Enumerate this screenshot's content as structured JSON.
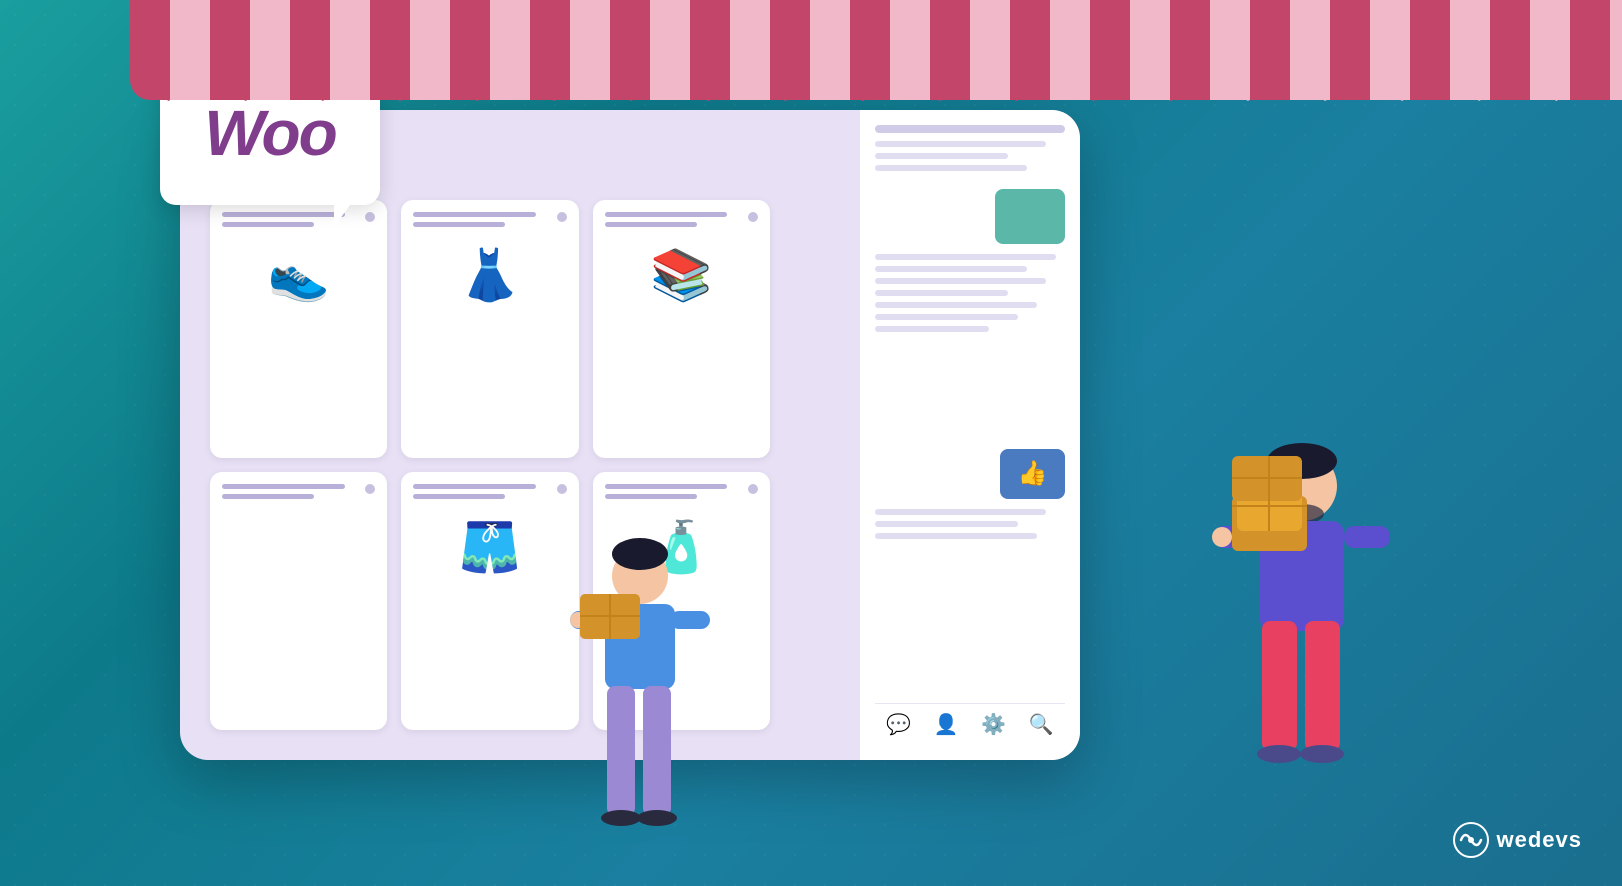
{
  "background": {
    "gradient_start": "#1a9e9e",
    "gradient_end": "#1a6e8e"
  },
  "woo_bubble": {
    "text": "Woo",
    "brand_color": "#7f3d8c"
  },
  "awning": {
    "color_dark": "#c4456a",
    "color_light": "#f0b8c8"
  },
  "product_cards": [
    {
      "id": 1,
      "icon": "👟",
      "name": "Sneakers"
    },
    {
      "id": 2,
      "icon": "👗",
      "name": "Dress"
    },
    {
      "id": 3,
      "icon": "📚",
      "name": "Books"
    },
    {
      "id": 4,
      "icon": "",
      "name": "Empty"
    },
    {
      "id": 5,
      "icon": "👖",
      "name": "Pants"
    },
    {
      "id": 6,
      "icon": "🧴",
      "name": "Bottle"
    }
  ],
  "right_panel": {
    "teal_block_color": "#5bb8a8",
    "like_button_color": "#4a7abf",
    "like_icon": "👍"
  },
  "bottom_icons": [
    {
      "name": "chat-icon",
      "symbol": "💬"
    },
    {
      "name": "user-icon",
      "symbol": "👤"
    },
    {
      "name": "settings-icon",
      "symbol": "⚙️"
    },
    {
      "name": "search-icon",
      "symbol": "🔍"
    }
  ],
  "wedevs": {
    "logo_text": "wedevs",
    "logo_color": "#ffffff"
  }
}
